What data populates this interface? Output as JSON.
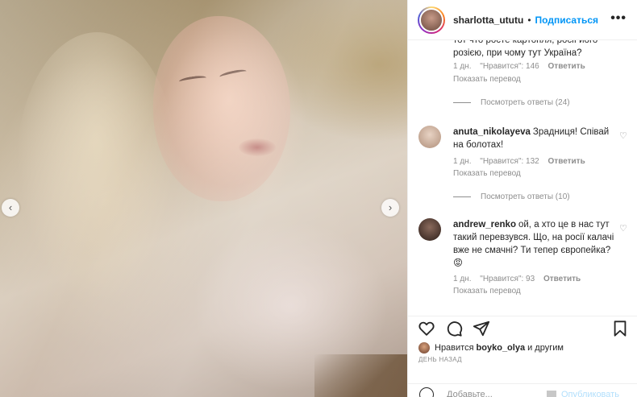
{
  "post": {
    "username": "sharlotta_ututu",
    "separator": "•",
    "follow_label": "Подписаться",
    "more_label": "•••"
  },
  "nav": {
    "prev_label": "‹",
    "next_label": "›"
  },
  "comments": [
    {
      "text": "тот что росте картопля, росії його розією, при чому тут Україна?",
      "time": "1 дн.",
      "likes": "\"Нравится\": 146",
      "reply": "Ответить",
      "translate": "Показать перевод",
      "view_replies": "Посмотреть ответы (24)"
    },
    {
      "user": "anuta_nikolayeva",
      "text": "Зрадниця! Співай на болотах!",
      "time": "1 дн.",
      "likes": "\"Нравится\": 132",
      "reply": "Ответить",
      "translate": "Показать перевод",
      "view_replies": "Посмотреть ответы (10)"
    },
    {
      "user": "andrew_renko",
      "text": "ой, а хто це в нас тут такий перевзувся. Що, на росії калачі вже не смачні? Ти тепер європейка? 😡",
      "time": "1 дн.",
      "likes": "\"Нравится\": 93",
      "reply": "Ответить",
      "translate": "Показать перевод"
    }
  ],
  "likes_line": {
    "prefix": "Нравится",
    "user": "boyko_olya",
    "suffix": "и другим"
  },
  "time_ago": "ДЕНЬ НАЗАД",
  "add_comment": {
    "placeholder": "Добавьте...",
    "publish_label": "Опубликовать"
  },
  "icons": {
    "heart": "heart-icon",
    "comment": "comment-icon",
    "share": "share-icon",
    "save": "bookmark-icon",
    "emoji": "emoji-icon"
  },
  "colors": {
    "link": "#0095f6",
    "muted": "#8e8e8e",
    "text": "#262626"
  }
}
